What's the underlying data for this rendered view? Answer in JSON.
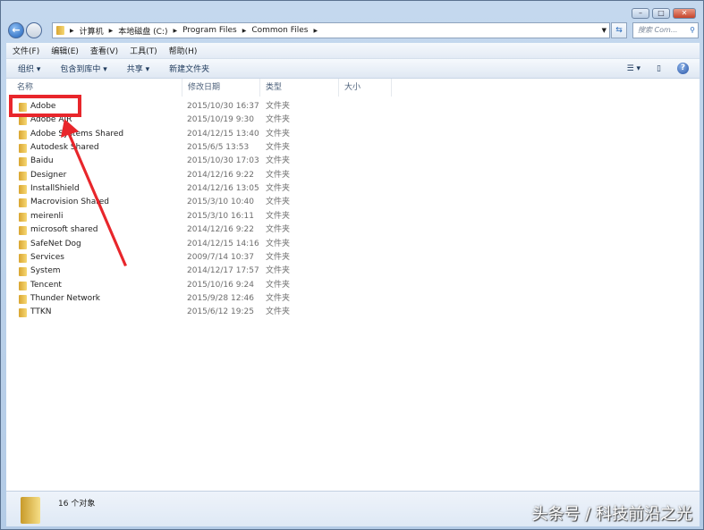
{
  "window": {
    "minimize": "–",
    "maximize": "□",
    "close": "✕"
  },
  "address": {
    "crumbs": [
      "计算机",
      "本地磁盘 (C:)",
      "Program Files",
      "Common Files"
    ]
  },
  "search": {
    "placeholder": "搜索 Com..."
  },
  "menu": [
    "文件(F)",
    "编辑(E)",
    "查看(V)",
    "工具(T)",
    "帮助(H)"
  ],
  "toolbar": {
    "organize": "组织 ▾",
    "include": "包含到库中 ▾",
    "share": "共享 ▾",
    "new_folder": "新建文件夹",
    "help": "?"
  },
  "columns": {
    "name": "名称",
    "date": "修改日期",
    "type": "类型",
    "size": "大小"
  },
  "files": [
    {
      "name": "Adobe",
      "date": "2015/10/30 16:37",
      "type": "文件夹"
    },
    {
      "name": "Adobe AIR",
      "date": "2015/10/19 9:30",
      "type": "文件夹"
    },
    {
      "name": "Adobe Systems Shared",
      "date": "2014/12/15 13:40",
      "type": "文件夹"
    },
    {
      "name": "Autodesk Shared",
      "date": "2015/6/5 13:53",
      "type": "文件夹"
    },
    {
      "name": "Baidu",
      "date": "2015/10/30 17:03",
      "type": "文件夹"
    },
    {
      "name": "Designer",
      "date": "2014/12/16 9:22",
      "type": "文件夹"
    },
    {
      "name": "InstallShield",
      "date": "2014/12/16 13:05",
      "type": "文件夹"
    },
    {
      "name": "Macrovision Shared",
      "date": "2015/3/10 10:40",
      "type": "文件夹"
    },
    {
      "name": "meirenli",
      "date": "2015/3/10 16:11",
      "type": "文件夹"
    },
    {
      "name": "microsoft shared",
      "date": "2014/12/16 9:22",
      "type": "文件夹"
    },
    {
      "name": "SafeNet Dog",
      "date": "2014/12/15 14:16",
      "type": "文件夹"
    },
    {
      "name": "Services",
      "date": "2009/7/14 10:37",
      "type": "文件夹"
    },
    {
      "name": "System",
      "date": "2014/12/17 17:57",
      "type": "文件夹"
    },
    {
      "name": "Tencent",
      "date": "2015/10/16 9:24",
      "type": "文件夹"
    },
    {
      "name": "Thunder Network",
      "date": "2015/9/28 12:46",
      "type": "文件夹"
    },
    {
      "name": "TTKN",
      "date": "2015/6/12 19:25",
      "type": "文件夹"
    }
  ],
  "status": {
    "count": "16 个对象"
  },
  "watermark": "头条号 / 科技前沿之光",
  "annotation": {
    "color": "#e8262b"
  }
}
